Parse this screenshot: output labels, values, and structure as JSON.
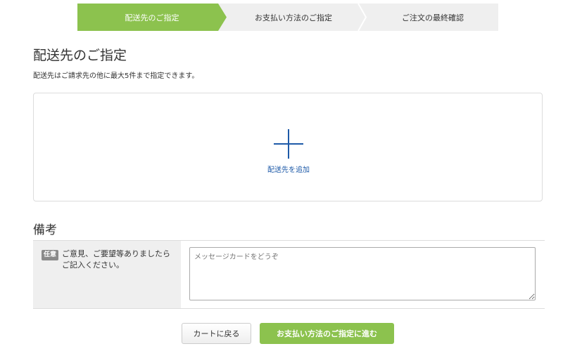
{
  "steps": [
    {
      "label": "配送先のご指定",
      "active": true
    },
    {
      "label": "お支払い方法のご指定",
      "active": false
    },
    {
      "label": "ご注文の最終確認",
      "active": false
    }
  ],
  "page": {
    "title": "配送先のご指定",
    "description": "配送先はご請求先の他に最大5件まで指定できます。"
  },
  "add_destination": {
    "label": "配送先を追加",
    "icon": "plus-icon"
  },
  "remarks": {
    "section_title": "備考",
    "badge": "任意",
    "label": "ご意見、ご要望等ありましたらご記入ください。",
    "placeholder": "メッセージカードをどうぞ"
  },
  "actions": {
    "back_label": "カートに戻る",
    "next_label": "お支払い方法のご指定に進む"
  },
  "colors": {
    "accent": "#8cc24e",
    "link": "#1e5aa8",
    "step_bg": "#efefef"
  }
}
